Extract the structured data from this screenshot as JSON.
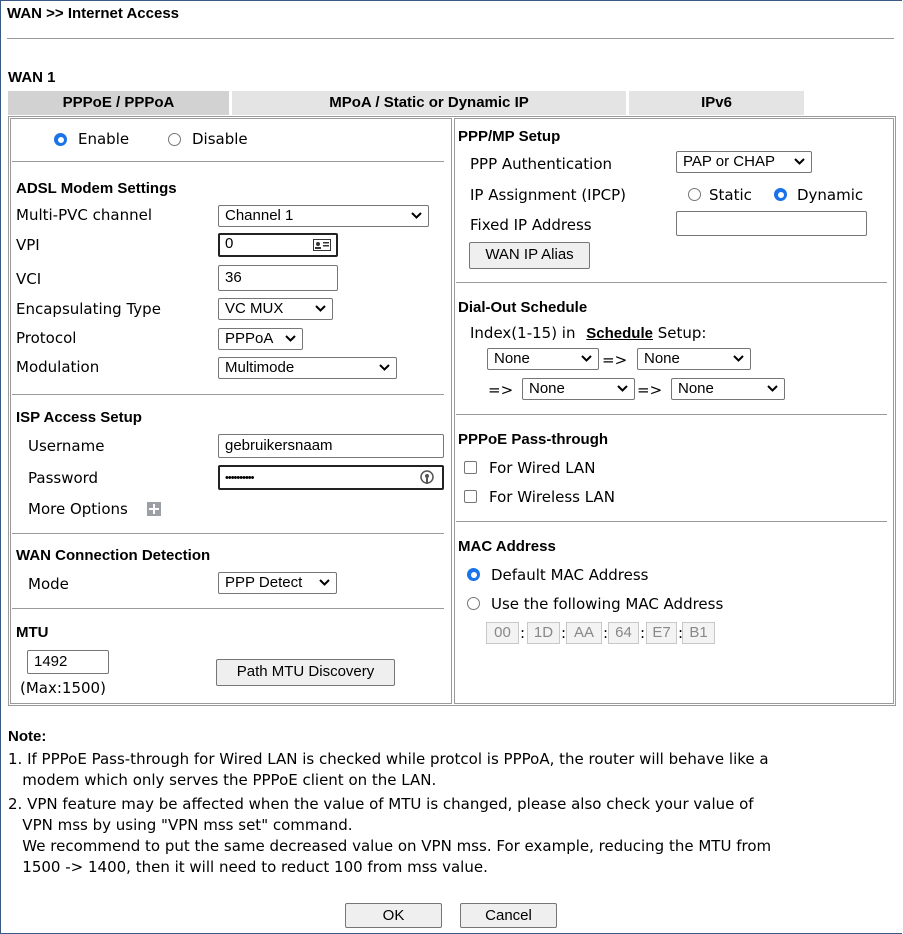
{
  "page": {
    "title": "WAN >> Internet Access"
  },
  "wan": {
    "label": "WAN 1",
    "tabs": [
      "PPPoE / PPPoA",
      "MPoA / Static or Dynamic IP",
      "IPv6"
    ]
  },
  "left": {
    "enable": "Enable",
    "disable": "Disable",
    "adsl": {
      "title": "ADSL Modem Settings",
      "multi_pvc_label": "Multi-PVC channel",
      "multi_pvc_value": "Channel 1",
      "vpi_label": "VPI",
      "vpi_value": "0",
      "vci_label": "VCI",
      "vci_value": "36",
      "encap_label": "Encapsulating Type",
      "encap_value": "VC MUX",
      "protocol_label": "Protocol",
      "protocol_value": "PPPoA",
      "modulation_label": "Modulation",
      "modulation_value": "Multimode"
    },
    "isp": {
      "title": "ISP Access Setup",
      "username_label": "Username",
      "username_value": "gebruikersnaam",
      "password_label": "Password",
      "password_value": "••••••••••",
      "more_options": "More Options"
    },
    "detection": {
      "title": "WAN Connection Detection",
      "mode_label": "Mode",
      "mode_value": "PPP Detect"
    },
    "mtu": {
      "title": "MTU",
      "value": "1492",
      "max": "(Max:1500)",
      "discovery_button": "Path MTU Discovery"
    }
  },
  "right": {
    "ppp": {
      "title": "PPP/MP Setup",
      "auth_label": "PPP Authentication",
      "auth_value": "PAP or CHAP",
      "ip_assign_label": "IP Assignment (IPCP)",
      "static": "Static",
      "dynamic": "Dynamic",
      "fixed_ip_label": "Fixed IP Address",
      "fixed_ip_value": "",
      "alias_button": "WAN IP Alias"
    },
    "schedule": {
      "title": "Dial-Out Schedule",
      "index_prefix": "Index(1-15) in",
      "index_link": "Schedule",
      "index_suffix": "Setup:",
      "arrow": "=>",
      "slots": [
        "None",
        "None",
        "None",
        "None"
      ]
    },
    "passthrough": {
      "title": "PPPoE Pass-through",
      "wired": "For Wired LAN",
      "wireless": "For Wireless LAN"
    },
    "mac": {
      "title": "MAC Address",
      "default": "Default MAC Address",
      "custom": "Use the following MAC Address",
      "octets": [
        "00",
        "1D",
        "AA",
        "64",
        "E7",
        "B1"
      ],
      "sep": ":"
    }
  },
  "notes": {
    "title": "Note:",
    "lines": [
      "1. If PPPoE Pass-through for Wired LAN is checked while protcol is PPPoA, the router will behave like a",
      "   modem which only serves the PPPoE client on the LAN.",
      "2. VPN feature may be affected when the value of MTU is changed, please also check your value of",
      "   VPN mss by using \"VPN mss set\" command.",
      "   We recommend to put the same decreased value on VPN mss. For example, reducing the MTU from",
      "   1500 -> 1400, then it will need to reduct 100 from mss value."
    ]
  },
  "buttons": {
    "ok": "OK",
    "cancel": "Cancel"
  },
  "colors": {
    "radio_selected": "#1a73e8",
    "frame_border": "#3a5a86"
  }
}
